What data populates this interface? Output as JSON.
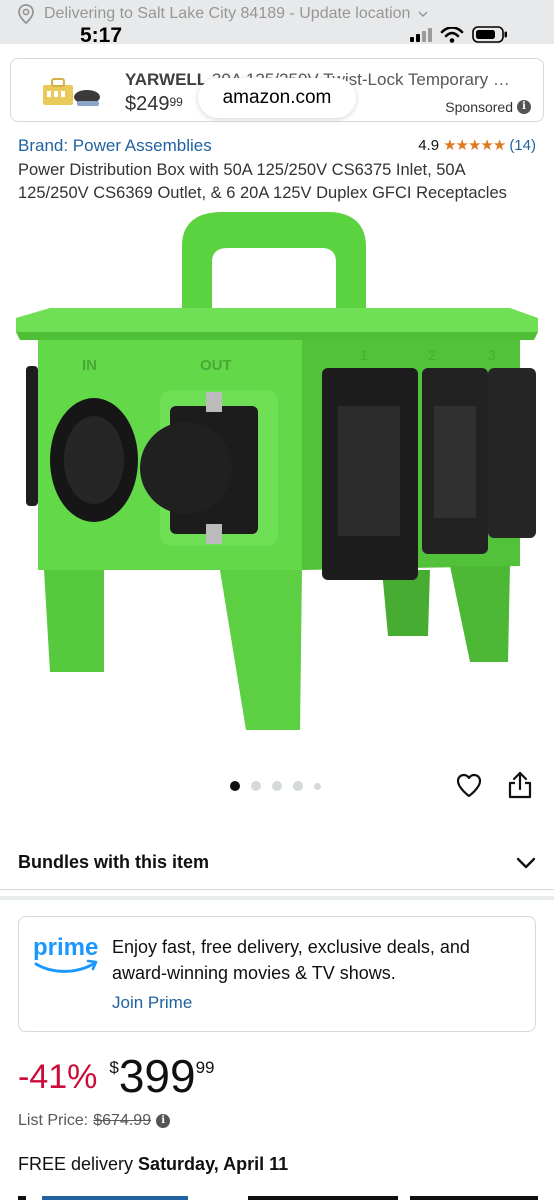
{
  "status_bar": {
    "time": "5:17",
    "delivery_banner": "Delivering to Salt Lake City 84189 - Update location"
  },
  "sponsored_ad": {
    "brand": "YARWELL",
    "title_rest": " 30A 125/250V Twist-Lock Temporary Po...",
    "price_whole": "$249",
    "price_fraction": "99",
    "sponsored_label": "Sponsored"
  },
  "browser": {
    "url": "amazon.com"
  },
  "product": {
    "brand_link": "Brand: Power Assemblies",
    "rating_value": "4.9",
    "rating_stars": "★★★★★",
    "rating_count": "(14)",
    "title": "Power Distribution Box with 50A 125/250V CS6375 Inlet, 50A 125/250V CS6369 Outlet, & 6 20A 125V Duplex GFCI Receptacles",
    "image_labels": {
      "in": "IN",
      "out": "OUT",
      "n1": "1",
      "n2": "2",
      "n3": "3"
    },
    "image_count": 5,
    "active_image_index": 0
  },
  "bundles": {
    "label": "Bundles with this item"
  },
  "prime": {
    "logo_text": "prime",
    "message": "Enjoy fast, free delivery, exclusive deals, and award-winning movies & TV shows.",
    "join_label": "Join Prime"
  },
  "pricing": {
    "discount": "-41%",
    "currency": "$",
    "whole": "399",
    "fraction": "99",
    "list_price_label": "List Price:",
    "list_price": "$674.99"
  },
  "delivery": {
    "prefix": "FREE delivery ",
    "date": "Saturday, April 11"
  },
  "colors": {
    "link": "#2162a1",
    "star": "#de7921",
    "discount": "#cc0c39",
    "product_green": "#63d94a"
  },
  "icons": [
    "location-pin-icon",
    "chevron-down-icon",
    "signal-icon",
    "wifi-icon",
    "battery-icon",
    "info-icon",
    "heart-icon",
    "share-icon"
  ]
}
